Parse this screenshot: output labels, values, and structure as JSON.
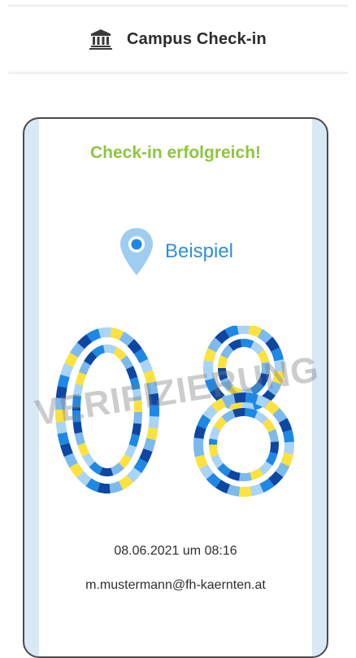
{
  "header": {
    "title": "Campus Check-in",
    "icon": "university-building-icon"
  },
  "card": {
    "status": "Check-in erfolgreich!",
    "location_icon": "location-pin-icon",
    "location": "Beispiel",
    "code": "08",
    "watermark": "VERIFIZIERUNG",
    "datetime": "08.06.2021 um 08:16",
    "email": "m.mustermann@fh-kaernten.at"
  },
  "colors": {
    "success": "#8cc63f",
    "accent": "#2f8fd6",
    "digit_palette": [
      "#fde13d",
      "#a9d4f5",
      "#1e88e5",
      "#0d47a1",
      "#7cb9ec"
    ]
  }
}
